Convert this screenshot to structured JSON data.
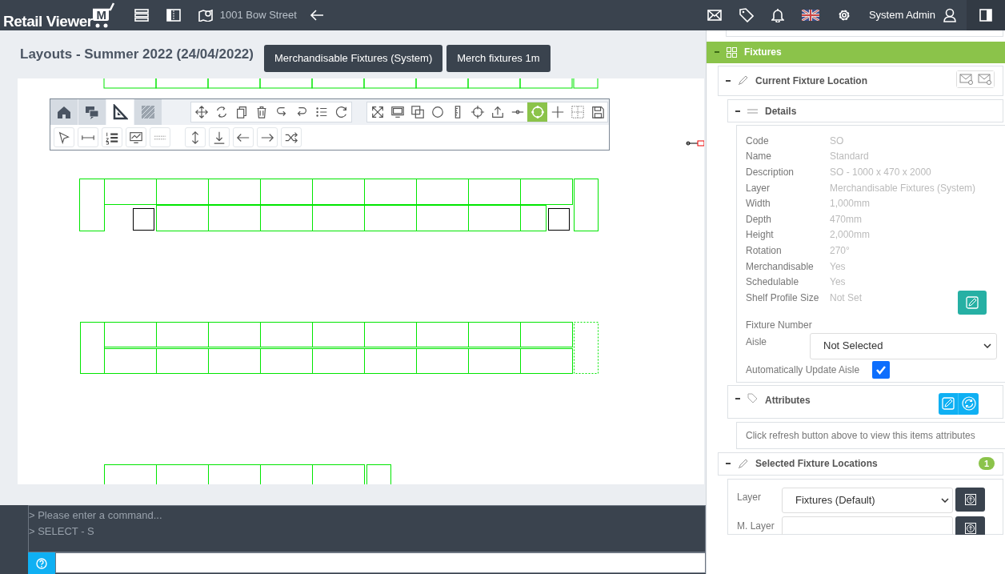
{
  "app": {
    "title": "Retail Viewer",
    "badge": "M"
  },
  "location": "1001 Bow Street",
  "user": "System Admin",
  "page_title": "Layouts - Summer 2022 (24/04/2022)",
  "layer_buttons": [
    "Merchandisable Fixtures (System)",
    "Merch fixtures 1m"
  ],
  "ribbon_tabs": [
    {
      "selected": false
    },
    {
      "selected": false
    },
    {
      "selected": true
    },
    {
      "selected": false
    }
  ],
  "tools": [
    {
      "selected": false
    },
    {
      "selected": false
    },
    {
      "selected": false
    },
    {
      "selected": false
    },
    {
      "selected": false
    },
    {
      "selected": false
    },
    {
      "selected": false
    },
    {
      "selected": false
    },
    {
      "selected": false
    },
    {
      "selected": false
    },
    {
      "selected": false
    },
    {
      "selected": false
    },
    {
      "selected": false
    },
    {
      "selected": false
    },
    {
      "selected": false
    },
    {
      "selected": false
    },
    {
      "selected": true
    },
    {
      "selected": false
    },
    {
      "selected": false
    },
    {
      "selected": false
    }
  ],
  "console": {
    "lines": [
      "> Please enter a command...",
      "> SELECT - S"
    ]
  },
  "panel": {
    "section": {
      "title": "Fixtures",
      "expanded": true
    },
    "current": {
      "title": "Current Fixture Location",
      "expanded": true,
      "details": {
        "title": "Details",
        "expanded": true,
        "fields": [
          {
            "label": "Code",
            "value": "SO"
          },
          {
            "label": "Name",
            "value": "Standard"
          },
          {
            "label": "Description",
            "value": "SO - 1000 x 470 x 2000"
          },
          {
            "label": "Layer",
            "value": "Merchandisable Fixtures (System)"
          },
          {
            "label": "Width",
            "value": "1,000mm"
          },
          {
            "label": "Depth",
            "value": "470mm"
          },
          {
            "label": "Height",
            "value": "2,000mm"
          },
          {
            "label": "Rotation",
            "value": "270°"
          },
          {
            "label": "Merchandisable",
            "value": "Yes"
          },
          {
            "label": "Schedulable",
            "value": "Yes"
          },
          {
            "label": "Shelf Profile Size",
            "value": "Not Set"
          }
        ],
        "fixture_number_label": "Fixture Number",
        "aisle": {
          "label": "Aisle",
          "value": "Not Selected"
        },
        "auto_update": {
          "label": "Automatically Update Aisle",
          "checked": true
        }
      },
      "attributes": {
        "title": "Attributes",
        "expanded": true,
        "message": "Click refresh button above to view this items attributes"
      }
    },
    "selected": {
      "title": "Selected Fixture Locations",
      "expanded": true,
      "count": "1",
      "layer": {
        "label": "Layer",
        "value": "Fixtures (Default)"
      },
      "m_layer": {
        "label": "M. Layer"
      }
    }
  }
}
